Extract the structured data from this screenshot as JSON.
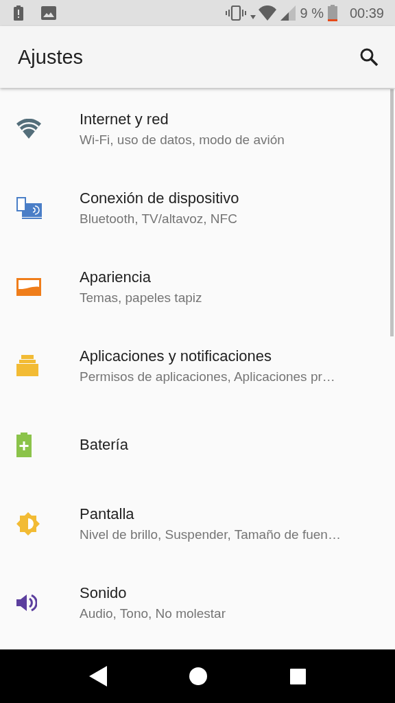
{
  "status_bar": {
    "battery_percent": "9 %",
    "time": "00:39"
  },
  "app_bar": {
    "title": "Ajustes"
  },
  "settings": [
    {
      "kind": "network",
      "color": "#546e7a",
      "title": "Internet y red",
      "subtitle": "Wi-Fi, uso de datos, modo de avión"
    },
    {
      "kind": "devices",
      "color": "#4a7ec7",
      "title": "Conexión de dispositivo",
      "subtitle": "Bluetooth, TV/altavoz, NFC"
    },
    {
      "kind": "appearance",
      "color": "#ef7d1a",
      "title": "Apariencia",
      "subtitle": "Temas, papeles tapiz"
    },
    {
      "kind": "apps",
      "color": "#f2bb34",
      "title": "Aplicaciones y notificaciones",
      "subtitle": "Permisos de aplicaciones, Aplicaciones pr…"
    },
    {
      "kind": "battery",
      "color": "#8bc34a",
      "title": "Batería"
    },
    {
      "kind": "display",
      "color": "#f2bb34",
      "title": "Pantalla",
      "subtitle": "Nivel de brillo, Suspender, Tamaño de fuen…"
    },
    {
      "kind": "sound",
      "color": "#5c3f9e",
      "title": "Sonido",
      "subtitle": "Audio, Tono, No molestar"
    }
  ]
}
